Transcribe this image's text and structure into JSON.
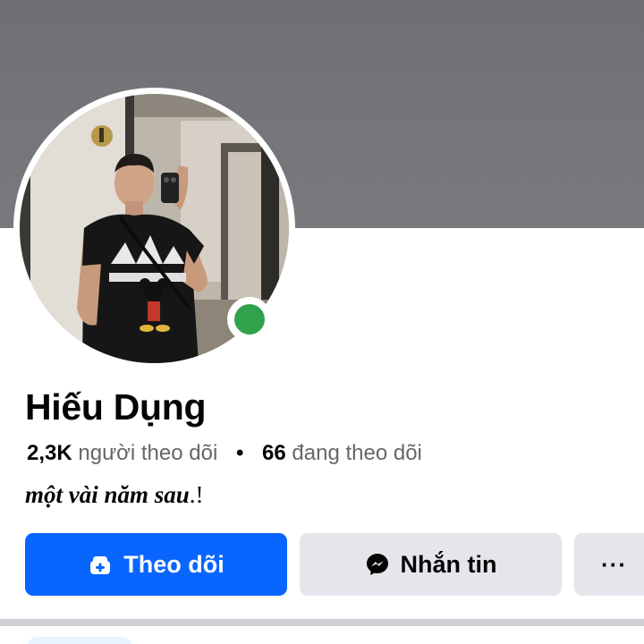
{
  "profile": {
    "name": "Hiếu Dụng",
    "followers_count": "2,3K",
    "followers_label": "người theo dõi",
    "separator": "•",
    "following_count": "66",
    "following_label": "đang theo dõi",
    "bio_text": "một vài năm sau",
    "bio_suffix": ".!",
    "online_status_color": "#31a24c"
  },
  "actions": {
    "follow_label": "Theo dõi",
    "message_label": "Nhắn tin",
    "more_label": "···"
  },
  "icons": {
    "follow": "follow-add-icon",
    "message": "messenger-icon"
  },
  "colors": {
    "primary": "#0866ff",
    "secondary_button": "#e4e6eb",
    "cover": "#75767a",
    "muted_text": "#65676b"
  }
}
